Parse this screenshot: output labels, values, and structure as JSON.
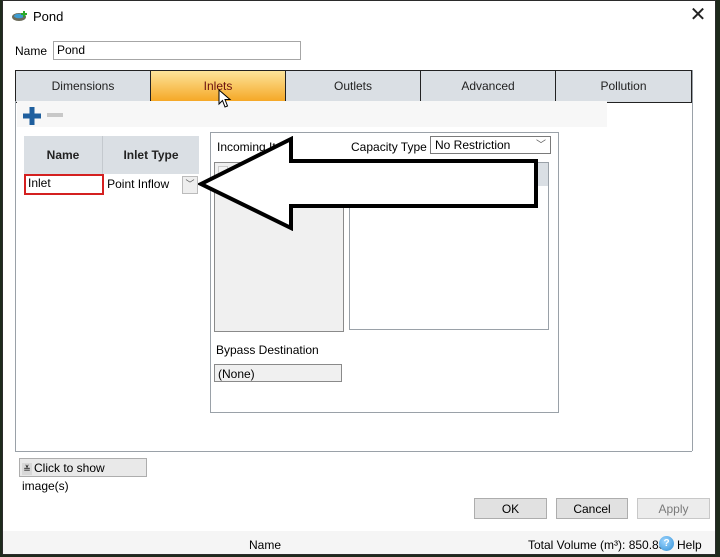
{
  "window": {
    "title": "Pond",
    "icon": "pond-icon",
    "close_icon": "close-icon"
  },
  "name_field": {
    "label": "Name",
    "value": "Pond"
  },
  "tabs": [
    {
      "label": "Dimensions",
      "active": false
    },
    {
      "label": "Inlets",
      "active": true
    },
    {
      "label": "Outlets",
      "active": false
    },
    {
      "label": "Advanced",
      "active": false
    },
    {
      "label": "Pollution",
      "active": false
    }
  ],
  "inlets": {
    "toolbar": {
      "add_icon": "plus-icon",
      "remove_icon": "minus-icon"
    },
    "grid": {
      "columns": [
        "Name",
        "Inlet Type"
      ],
      "rows": [
        {
          "name": "Inlet",
          "inlet_type": "Point Inflow"
        }
      ]
    },
    "detail": {
      "incoming_items_label": "Incoming Items",
      "incoming_items_visible_label": "Incoming Item",
      "capacity_type_label": "Capacity Type",
      "capacity_type_value": "No Restriction",
      "bypass_label": "Bypass Destination",
      "bypass_value": "(None)"
    }
  },
  "show_images_button": "Click to show image(s)",
  "buttons": {
    "ok": "OK",
    "cancel": "Cancel",
    "apply": "Apply"
  },
  "status": {
    "name": "Name",
    "total_volume": "Total Volume (m³): 850.833",
    "help": "Help"
  },
  "annotation": {
    "type": "arrow-left",
    "color": "#000000"
  }
}
